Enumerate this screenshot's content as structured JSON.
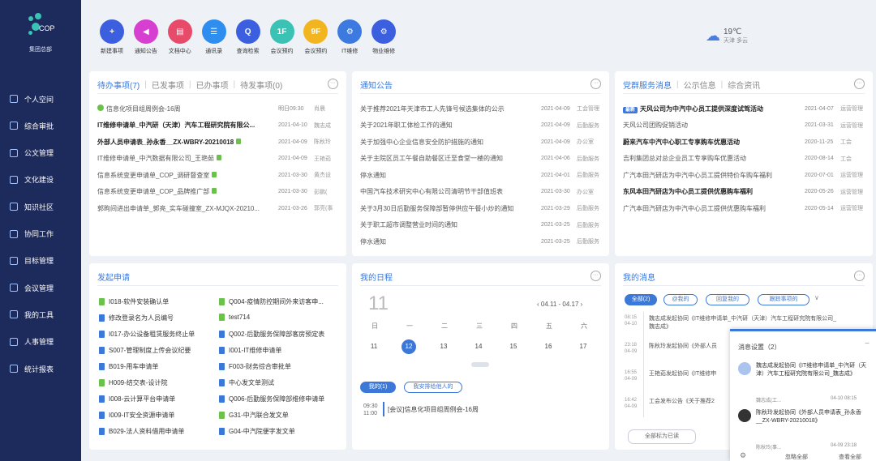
{
  "logo": {
    "name": "COP",
    "org": "集团总部"
  },
  "sidebar": {
    "items": [
      {
        "label": "个人空间"
      },
      {
        "label": "综合审批"
      },
      {
        "label": "公文管理"
      },
      {
        "label": "文化建设"
      },
      {
        "label": "知识社区"
      },
      {
        "label": "协同工作"
      },
      {
        "label": "目标管理"
      },
      {
        "label": "会议管理"
      },
      {
        "label": "我的工具"
      },
      {
        "label": "人事管理"
      },
      {
        "label": "统计报表"
      }
    ]
  },
  "toolbar": [
    {
      "label": "新建事项",
      "color": "#3c5fe0",
      "glyph": "+"
    },
    {
      "label": "通知公告",
      "color": "#d63fd0",
      "glyph": "◀"
    },
    {
      "label": "文档中心",
      "color": "#e84a6a",
      "glyph": "▤"
    },
    {
      "label": "通讯录",
      "color": "#2e8ef0",
      "glyph": "☰"
    },
    {
      "label": "查询检索",
      "color": "#3c5fe0",
      "glyph": "Q"
    },
    {
      "label": "会议预约",
      "color": "#3ac3b4",
      "glyph": "1F"
    },
    {
      "label": "会议预约",
      "color": "#f2b51f",
      "glyph": "9F"
    },
    {
      "label": "IT维修",
      "color": "#3c7ae0",
      "glyph": "⚙"
    },
    {
      "label": "物业维修",
      "color": "#3c5fe0",
      "glyph": "⚙"
    }
  ],
  "weather": {
    "temp": "19℃",
    "desc": "天津 多云"
  },
  "todo": {
    "tabs": [
      "待办事项(7)",
      "已发事项",
      "已办事项",
      "待发事项(0)"
    ],
    "rows": [
      {
        "title": "信息化项目组周例会-16周",
        "date": "明日09:30",
        "person": "肖晨",
        "bold": false,
        "ok": true
      },
      {
        "title": "IT维修申请单_中汽研（天津）汽车工程研究院有限公...",
        "date": "2021-04-10",
        "person": "魏志成",
        "bold": true
      },
      {
        "title": "外部人员申请表_孙永香__ZX-WBRY-20210018",
        "date": "2021-04-09",
        "person": "陈秋玲",
        "bold": true,
        "dot": true
      },
      {
        "title": "IT维修申请单_中汽数据有限公司_王艳茹",
        "date": "2021-04-09",
        "person": "王艳茹",
        "bold": false,
        "dot": true
      },
      {
        "title": "信息系统变更申请单_COP_调研督查室",
        "date": "2021-03-30",
        "person": "黄杰设",
        "bold": false,
        "dot": true
      },
      {
        "title": "信息系统变更申请单_COP_品牌推广部",
        "date": "2021-03-30",
        "person": "彭鹏(",
        "bold": false,
        "dot": true
      },
      {
        "title": "郭昫间进出申请单_郭亮_实车碰撞室_ZX-MJQX-20210...",
        "date": "2021-03-26",
        "person": "郭亮(事",
        "bold": false
      }
    ]
  },
  "notice": {
    "title": "通知公告",
    "rows": [
      {
        "title": "关于推荐2021年天津市工人先锋号候选集体的公示",
        "date": "2021-04-09",
        "dept": "工会管理"
      },
      {
        "title": "关于2021年职工体检工作的通知",
        "date": "2021-04-09",
        "dept": "后勤服务"
      },
      {
        "title": "关于加强中心企业信息安全防护措施的通知",
        "date": "2021-04-09",
        "dept": "办公室"
      },
      {
        "title": "关于主院区员工午餐自助餐区迁至食堂一楼的通知",
        "date": "2021-04-06",
        "dept": "后勤服务"
      },
      {
        "title": "停水通知",
        "date": "2021-04-01",
        "dept": "后勤服务"
      },
      {
        "title": "中国汽车技术研究中心有限公司清明节干部值班表",
        "date": "2021-03-30",
        "dept": "办公室"
      },
      {
        "title": "关于3月30日后勤服务保障部暂停供应午餐小炒的通知",
        "date": "2021-03-29",
        "dept": "后勤服务"
      },
      {
        "title": "关于职工超市调整营业时间的通知",
        "date": "2021-03-25",
        "dept": "后勤服务"
      },
      {
        "title": "停水通知",
        "date": "2021-03-25",
        "dept": "后勤服务"
      }
    ]
  },
  "party": {
    "tabs": [
      "党群服务消息",
      "公示信息",
      "综合资讯"
    ],
    "new_label": "最新",
    "rows": [
      {
        "title": "天风公司为中汽中心员工提供深度试驾活动",
        "date": "2021-04-07",
        "dept": "运营管理",
        "bold": true,
        "new": true
      },
      {
        "title": "天风公司团购促销活动",
        "date": "2021-03-31",
        "dept": "运营管理"
      },
      {
        "title": "蔚来汽车中汽中心职工专享购车优惠活动",
        "date": "2020-11-25",
        "dept": "工会",
        "bold": true
      },
      {
        "title": "吉利集团总对总企业员工专享购车优惠活动",
        "date": "2020-08-14",
        "dept": "工会"
      },
      {
        "title": "广汽本田汽研店为中汽中心员工提供特价车购车福利",
        "date": "2020-07-01",
        "dept": "运营管理"
      },
      {
        "title": "东风本田汽研店为中心员工提供优惠购车福利",
        "date": "2020-05-26",
        "dept": "运营管理",
        "bold": true
      },
      {
        "title": "广汽本田汽研店为中汽中心员工提供优惠购车福利",
        "date": "2020-05-14",
        "dept": "运营管理"
      }
    ]
  },
  "apply": {
    "title": "发起申请",
    "left": [
      {
        "label": "I018-软件安装确认单",
        "c": "#6bc24a"
      },
      {
        "label": "修改登录名为人员编号",
        "c": "#3c78d8"
      },
      {
        "label": "I017-办公设备租赁服务终止单",
        "c": "#3c78d8"
      },
      {
        "label": "S007-管理制度上传会议纪要",
        "c": "#3c78d8"
      },
      {
        "label": "B019-用车申请单",
        "c": "#3c78d8"
      },
      {
        "label": "H009-结交表-设计院",
        "c": "#6bc24a"
      },
      {
        "label": "I008-云计算平台申请单",
        "c": "#3c78d8"
      },
      {
        "label": "I009-IT安全资源申请单",
        "c": "#3c78d8"
      },
      {
        "label": "B029-法人资料借用申请单",
        "c": "#3c78d8"
      }
    ],
    "right": [
      {
        "label": "Q004-疫情防控期间外来访客申...",
        "c": "#6bc24a"
      },
      {
        "label": "test714",
        "c": "#6bc24a"
      },
      {
        "label": "Q002-后勤服务保障部客房预定表",
        "c": "#3c78d8"
      },
      {
        "label": "I001-IT维修申请单",
        "c": "#3c78d8"
      },
      {
        "label": "F003-财务综合审批单",
        "c": "#3c78d8"
      },
      {
        "label": "中心发文单测试",
        "c": "#3c78d8"
      },
      {
        "label": "Q006-后勤服务保障部维修申请单",
        "c": "#3c78d8"
      },
      {
        "label": "G31-中汽联合发文单",
        "c": "#6bc24a"
      },
      {
        "label": "G04-中汽院便字发文单",
        "c": "#3c78d8"
      }
    ]
  },
  "schedule": {
    "title": "我的日程",
    "month": "11",
    "range": "04.11 - 04.17",
    "weekdays": [
      "日",
      "一",
      "二",
      "三",
      "四",
      "五",
      "六"
    ],
    "days": [
      "11",
      "12",
      "13",
      "14",
      "15",
      "16",
      "17"
    ],
    "today_index": 1,
    "tabs": [
      "我的(1)",
      "我安排给他人的"
    ],
    "event_time": "09:30",
    "event_end": "11:00",
    "event_title": "[会议]信息化项目组周例会-16周"
  },
  "messages": {
    "title": "我的消息",
    "filters": [
      "全部(2)",
      "@我的",
      "回复我的",
      "跟踪事项的"
    ],
    "items": [
      {
        "time": "08:15",
        "date": "04-10",
        "text": "魏志成发起协同《IT维修申请单_中汽研（天津）汽车工程研究院有限公司_",
        "sub": "魏志成》"
      },
      {
        "time": "23:18",
        "date": "04-09",
        "text": "陈秋玲发起协同《外部人员"
      },
      {
        "time": "16:55",
        "date": "04-09",
        "text": "王艳茹发起协同《IT维修申"
      },
      {
        "time": "16:42",
        "date": "04-09",
        "text": "工会发布公告《关于推荐2"
      },
      {
        "time": "",
        "date": "",
        "text": "..."
      }
    ],
    "mark_all": "全部标为已读"
  },
  "popup": {
    "title": "消息设置（2）",
    "items": [
      {
        "text": "魏志成发起协同《IT维修申请单_中汽研（天津）汽车工程研究院有限公司_魏志成》",
        "who": "魏志成(工...",
        "date": "04-10 08:15"
      },
      {
        "text": "陈秋玲发起协同《外部人员申请表_孙永香__ZX-WBRY-20210018》",
        "who": "陈秋玲(事...",
        "date": "04-09 23:18"
      }
    ],
    "ignore": "忽略全部",
    "view": "查看全部"
  }
}
